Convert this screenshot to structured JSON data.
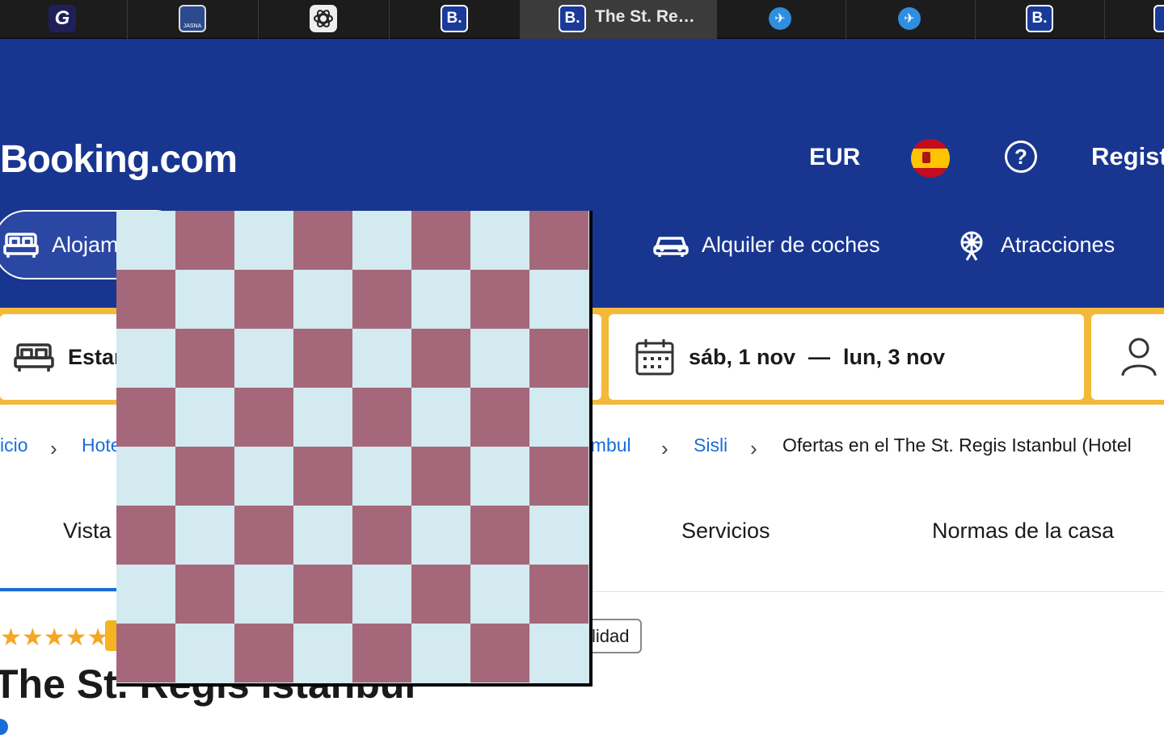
{
  "browser": {
    "tabs": [
      {
        "icon": "g-icon",
        "glyph": "G"
      },
      {
        "icon": "jasna-icon",
        "glyph": "JASNA"
      },
      {
        "icon": "openai-icon",
        "glyph": "✿"
      },
      {
        "icon": "booking-icon",
        "glyph": "B."
      },
      {
        "icon": "booking-icon",
        "glyph": "B.",
        "title": "The St. Re…"
      },
      {
        "icon": "plane-icon",
        "glyph": "✈"
      },
      {
        "icon": "plane-icon",
        "glyph": "✈"
      },
      {
        "icon": "booking-icon",
        "glyph": "B."
      }
    ]
  },
  "header": {
    "logo": "Booking.com",
    "currency": "EUR",
    "register": "Regist",
    "nav": {
      "stays": "Alojam",
      "cars": "Alquiler de coches",
      "attractions": "Atracciones"
    }
  },
  "search": {
    "destination": "Estar",
    "checkin": "sáb, 1 nov",
    "separator": "—",
    "checkout": "lun, 3 nov"
  },
  "breadcrumb": {
    "items": [
      "icio",
      "Hote",
      "ambul",
      "Sisli"
    ],
    "current": "Ofertas en el The St. Regis Istanbul (Hotel"
  },
  "property_tabs": {
    "overview": "Vista",
    "services": "Servicios",
    "house_rules": "Normas de la casa"
  },
  "hotel": {
    "stars": "★★★★★",
    "tag": "lidad",
    "name": "The St. Regis Istanbul"
  },
  "overlay": {
    "rows": 8,
    "cols": 8,
    "color_a": "#a5687a",
    "color_b": "#d2eaf0"
  },
  "colors": {
    "brand_blue": "#183690",
    "search_yellow": "#f3b93a",
    "link_blue": "#1a6dd6"
  }
}
